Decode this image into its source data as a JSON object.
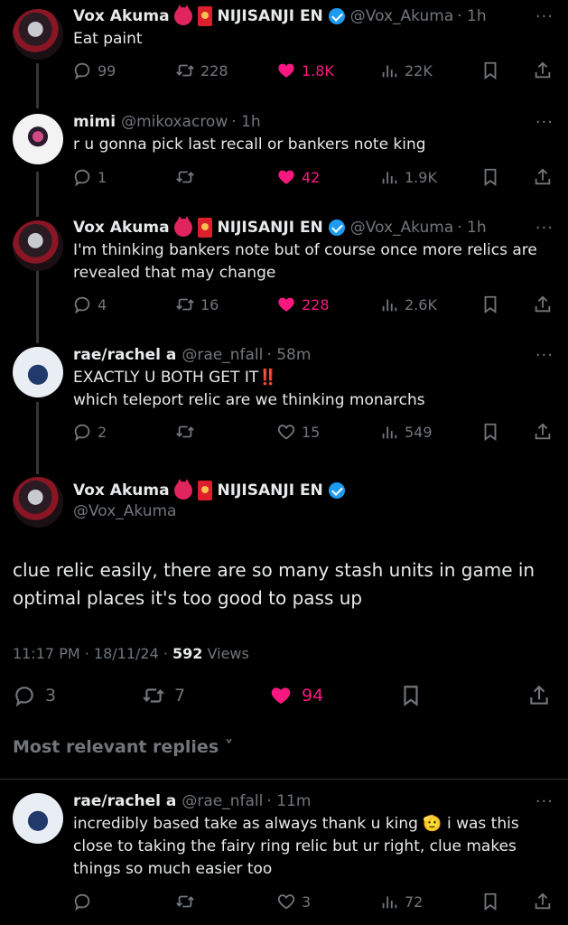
{
  "tweets": [
    {
      "name": "Vox Akuma",
      "org": "NIJISANJI EN",
      "handle": "@Vox_Akuma",
      "time": "· 1h",
      "text": "Eat paint",
      "replies": "99",
      "retweets": "228",
      "likes": "1.8K",
      "views": "22K",
      "liked": true
    },
    {
      "name": "mimi",
      "handle": "@mikoxacrow",
      "time": "· 1h",
      "text": "r u gonna pick last recall or bankers note king",
      "replies": "1",
      "retweets": "",
      "likes": "42",
      "views": "1.9K",
      "liked": true
    },
    {
      "name": "Vox Akuma",
      "org": "NIJISANJI EN",
      "handle": "@Vox_Akuma",
      "time": "· 1h",
      "text": "I'm thinking bankers note but of course once more relics are revealed that may change",
      "replies": "4",
      "retweets": "16",
      "likes": "228",
      "views": "2.6K",
      "liked": true
    },
    {
      "name": "rae/rachel a",
      "handle": "@rae_nfall",
      "time": "· 58m",
      "text_line1": "EXACTLY U BOTH GET IT",
      "text_bang": "‼️",
      "text_line2": "which teleport relic are we thinking monarchs",
      "replies": "2",
      "retweets": "",
      "likes": "15",
      "views": "549",
      "liked": false
    }
  ],
  "main": {
    "name": "Vox Akuma",
    "org": "NIJISANJI EN",
    "handle": "@Vox_Akuma",
    "text": "clue relic easily, there are so many stash units in game in optimal places it's too good to pass up",
    "time": "11:17 PM · 18/11/24 · ",
    "views_count": "592",
    "views_label": " Views",
    "replies": "3",
    "retweets": "7",
    "likes": "94"
  },
  "relevant_label": "Most relevant replies ˅",
  "reply": {
    "name": "rae/rachel a",
    "handle": "@rae_nfall",
    "time": "· 11m",
    "text_a": "incredibly based take as always thank u king ",
    "emoji": "🫡",
    "text_b": " i was this close to taking the fairy ring relic but ur right, clue makes things so much easier too",
    "replies": "",
    "retweets": "",
    "likes": "3",
    "views": "72"
  },
  "more_label": "···",
  "colors": {
    "bg": "#000000",
    "muted": "#71767b",
    "like": "#f91880",
    "verified": "#1d9bf0"
  }
}
